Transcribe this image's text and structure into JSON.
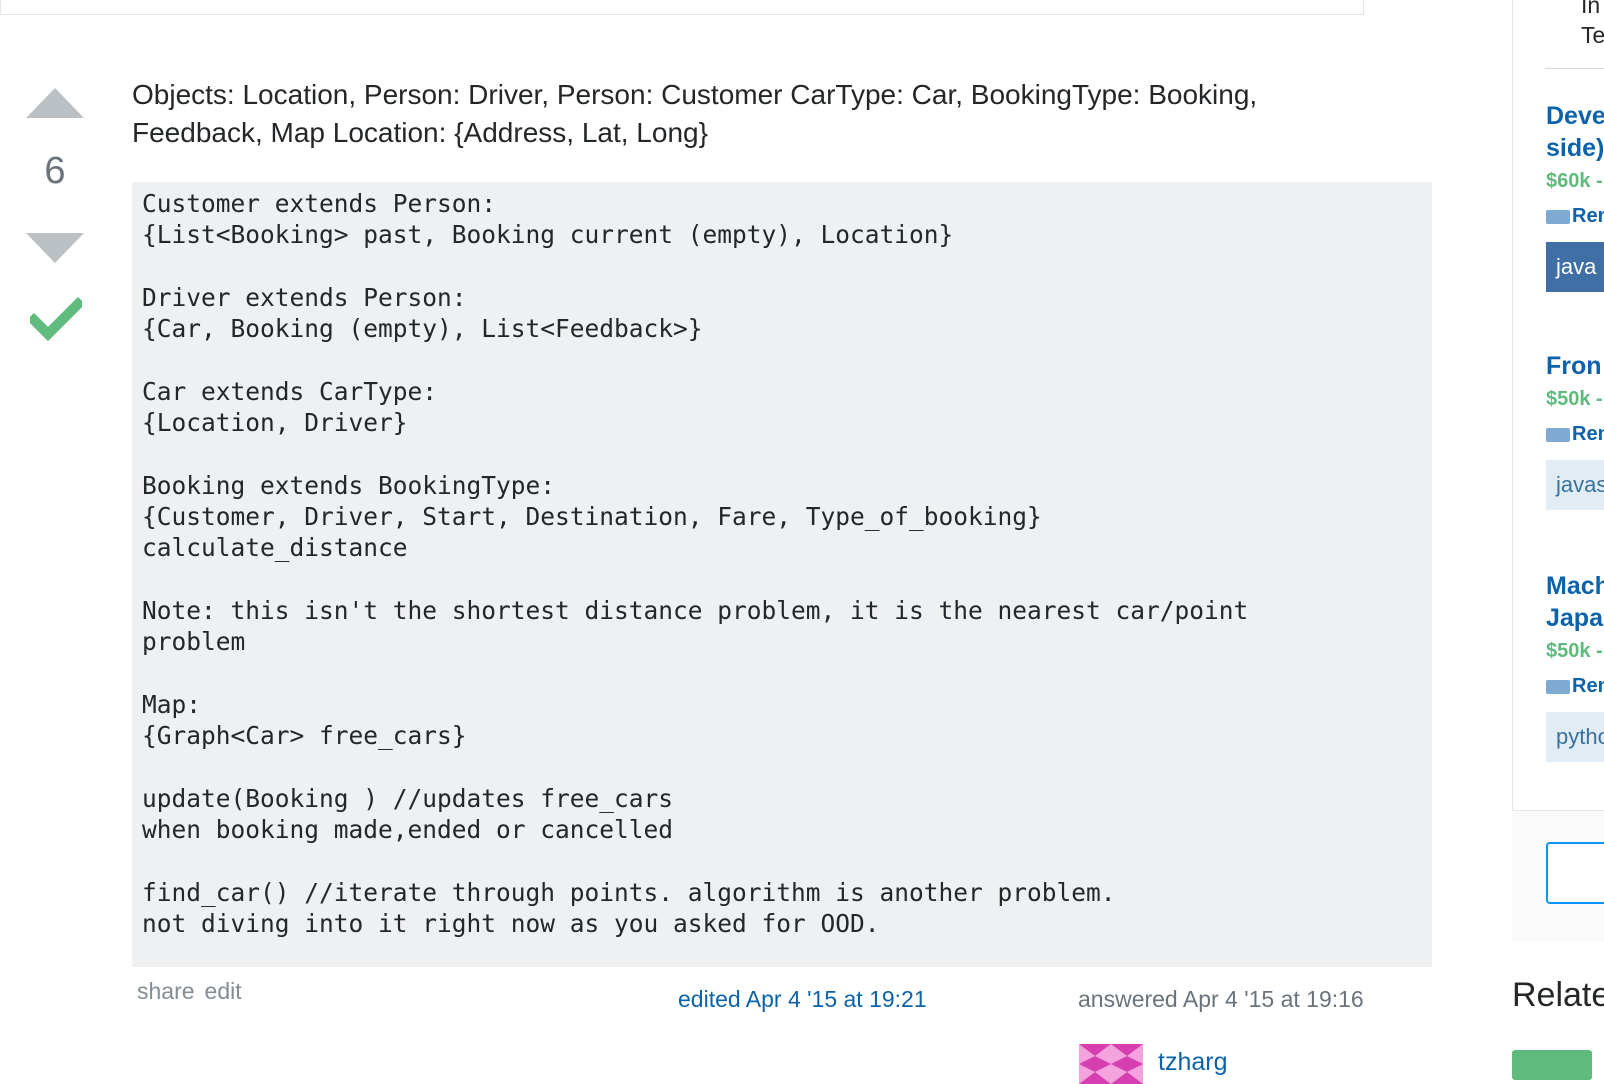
{
  "vote": {
    "count": "6"
  },
  "post": {
    "text": "Objects: Location, Person: Driver, Person: Customer CarType: Car, BookingType: Booking, Feedback, Map Location: {Address, Lat, Long}",
    "code": "Customer extends Person:\n{List<Booking> past, Booking current (empty), Location}\n\nDriver extends Person:\n{Car, Booking (empty), List<Feedback>}\n\nCar extends CarType:\n{Location, Driver}\n\nBooking extends BookingType:\n{Customer, Driver, Start, Destination, Fare, Type_of_booking}\ncalculate_distance\n\nNote: this isn't the shortest distance problem, it is the nearest car/point\nproblem\n\nMap:\n{Graph<Car> free_cars}\n\nupdate(Booking ) //updates free_cars\nwhen booking made,ended or cancelled\n\nfind_car() //iterate through points. algorithm is another problem.\nnot diving into it right now as you asked for OOD."
  },
  "menu": {
    "share": "share",
    "edit": "edit"
  },
  "signature": {
    "edited": "edited Apr 4 '15 at 19:21",
    "answered": "answered Apr 4 '15 at 19:16",
    "user": "tzharg"
  },
  "sidebar": {
    "top_text": "In\nTe",
    "jobs": [
      {
        "title": "Deve\nside)",
        "salary": "$60k -",
        "remote": "Rem",
        "tag": "java"
      },
      {
        "title": "Fron",
        "salary": "$50k -",
        "remote": "Rem",
        "tag": "javas"
      },
      {
        "title": "Mach\nJapa",
        "salary": "$50k -",
        "remote": "Rem",
        "tag": "pytho"
      }
    ],
    "related": "Related"
  },
  "colors": {
    "accepted": "#5eba7d",
    "link": "#0c63ab",
    "vote_arrow": "#bbc0c4",
    "code_bg": "#eff0f1"
  }
}
